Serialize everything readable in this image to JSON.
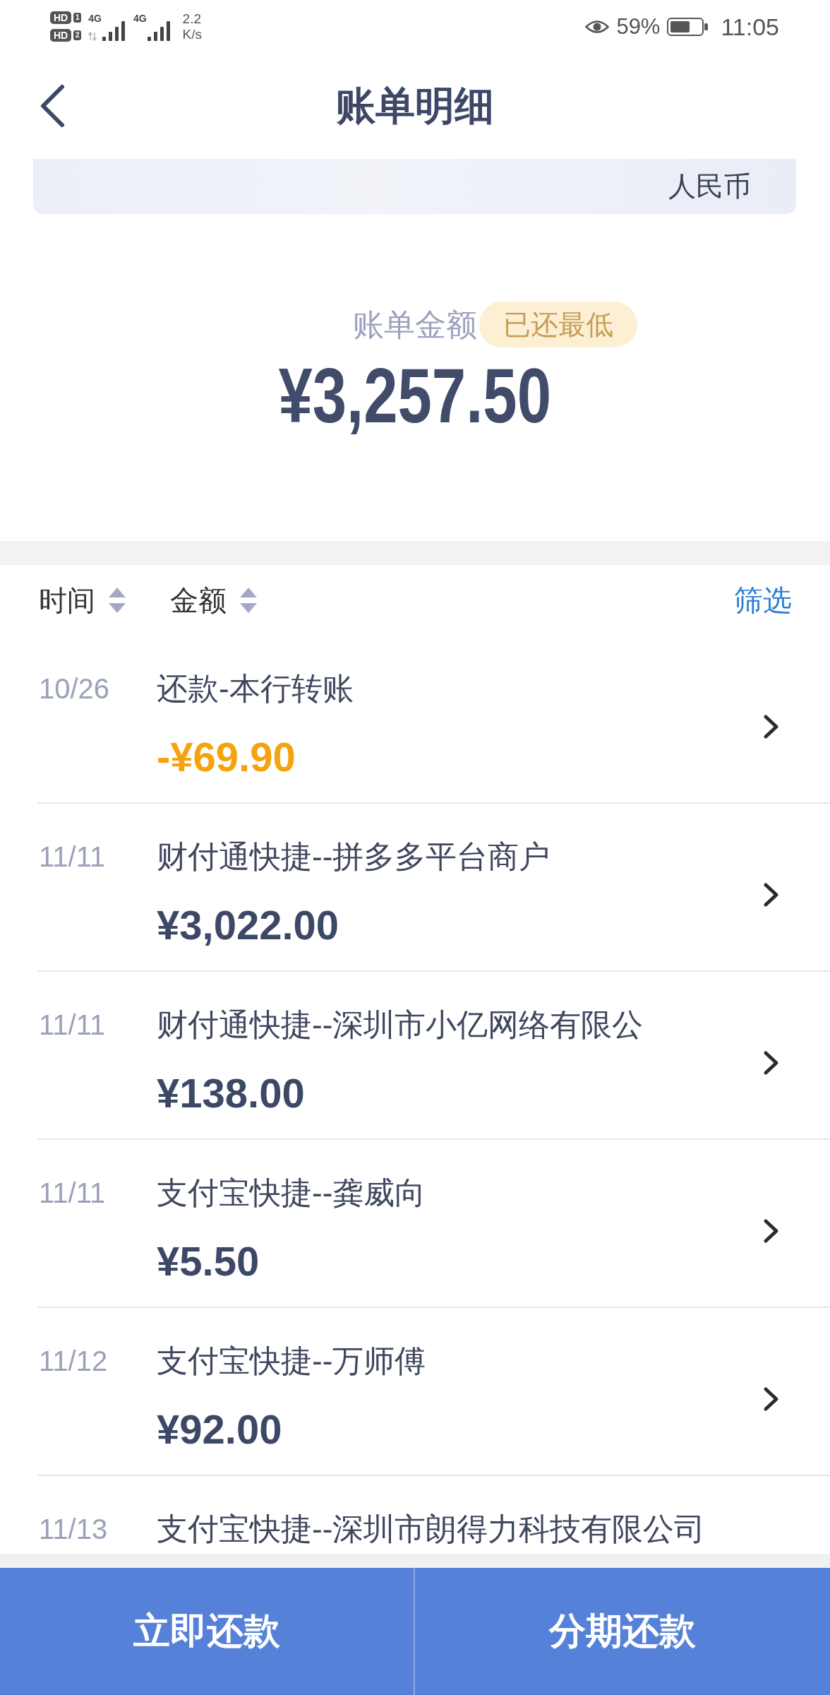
{
  "status_bar": {
    "sims": [
      {
        "label": "HD",
        "slot": "1"
      },
      {
        "label": "HD",
        "slot": "2"
      }
    ],
    "networks": [
      {
        "label": "4G",
        "activity": true
      },
      {
        "label": "4G",
        "activity": false
      }
    ],
    "speed": "2.2",
    "speed_unit": "K/s",
    "battery_percent": "59%",
    "time": "11:05"
  },
  "header": {
    "title": "账单明细"
  },
  "currency_card": {
    "currency": "人民币"
  },
  "bill": {
    "label": "账单金额",
    "badge": "已还最低",
    "amount": "¥3,257.50"
  },
  "list_header": {
    "sort_options": [
      {
        "label": "时间"
      },
      {
        "label": "金额"
      }
    ],
    "filter": "筛选"
  },
  "transactions": [
    {
      "date": "10/26",
      "title": "还款-本行转账",
      "amount": "-¥69.90",
      "kind": "repayment"
    },
    {
      "date": "11/11",
      "title": "财付通快捷--拼多多平台商户",
      "amount": "¥3,022.00",
      "kind": "purchase"
    },
    {
      "date": "11/11",
      "title": "财付通快捷--深圳市小亿网络有限公",
      "amount": "¥138.00",
      "kind": "purchase"
    },
    {
      "date": "11/11",
      "title": "支付宝快捷--龚威向",
      "amount": "¥5.50",
      "kind": "purchase"
    },
    {
      "date": "11/12",
      "title": "支付宝快捷--万师傅",
      "amount": "¥92.00",
      "kind": "purchase"
    },
    {
      "date": "11/13",
      "title": "支付宝快捷--深圳市朗得力科技有限公司"
    }
  ],
  "actions": [
    "立即还款",
    "分期还款"
  ]
}
